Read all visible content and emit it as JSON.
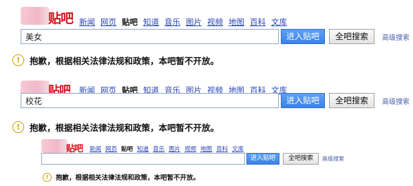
{
  "logo_text": "贴吧",
  "nav_items": [
    "新闻",
    "网页",
    "贴吧",
    "知道",
    "音乐",
    "图片",
    "视频",
    "地图",
    "百科",
    "文库"
  ],
  "nav_active": "贴吧",
  "enter_button": "进入贴吧",
  "search_all_button": "全吧搜索",
  "advanced_search": "高级搜索",
  "notice_text": "抱歉，根据相关法律法规和政策，本吧暂不开放。",
  "warning_glyph": "!",
  "blocks": [
    {
      "query": "美女"
    },
    {
      "query": "校花"
    },
    {
      "query": ""
    }
  ]
}
